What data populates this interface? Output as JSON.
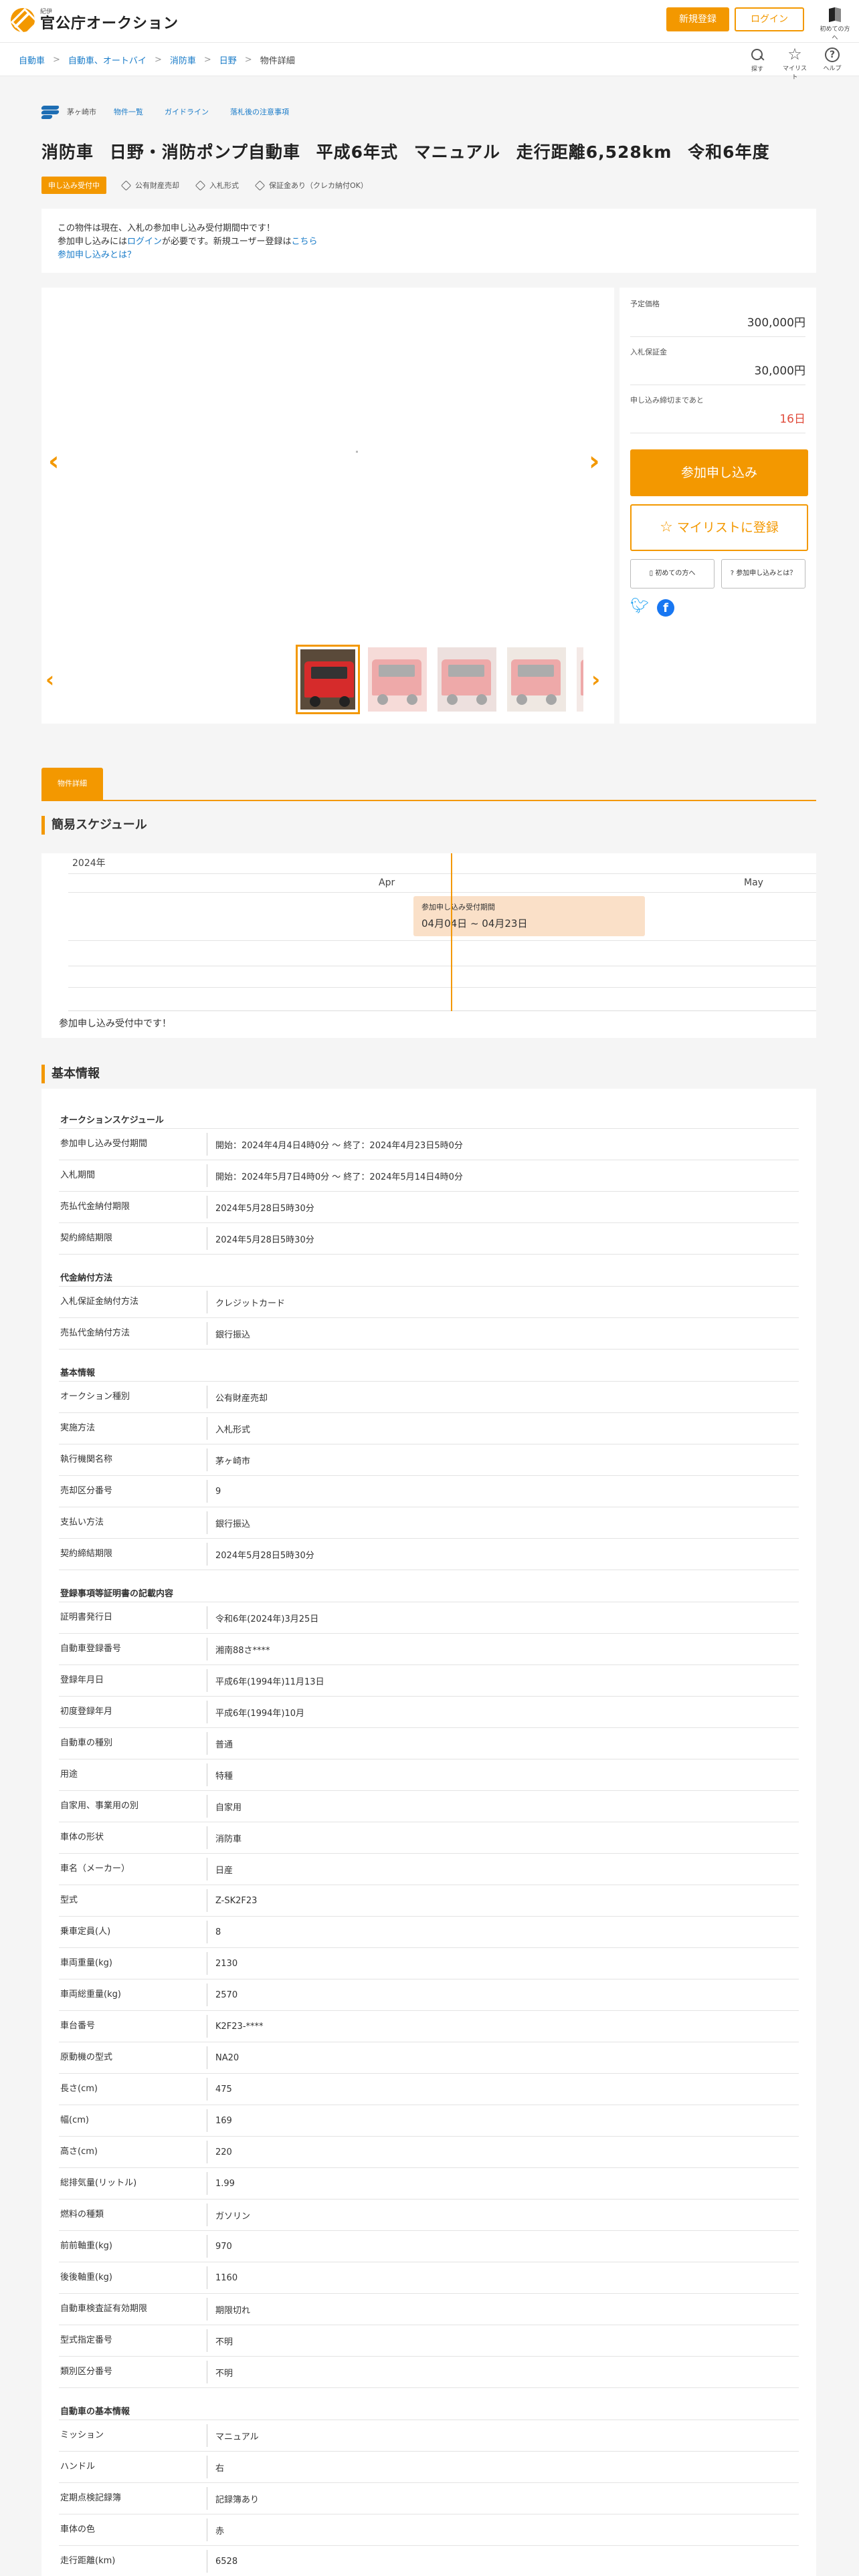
{
  "header": {
    "logo_sub": "紀伊",
    "logo_main": "官公庁オークション",
    "register_label": "新規登録",
    "login_label": "ログイン",
    "beginner_label": "初めての方へ"
  },
  "breadcrumb": [
    "自動車",
    "自動車、オートバイ",
    "消防車",
    "日野",
    "物件詳細"
  ],
  "tools": {
    "search": "探す",
    "mylist": "マイリスト",
    "help": "ヘルプ"
  },
  "subnav": {
    "org": "茅ヶ崎市",
    "links": [
      "物件一覧",
      "ガイドライン",
      "落札後の注意事項"
    ]
  },
  "title": "消防車 日野・消防ポンプ自動車 平成6年式 マニュアル 走行距離6,528km 令和6年度",
  "badge": "申し込み受付中",
  "tags": [
    "公有財産売却",
    "入札形式",
    "保証金あり（クレカ納付OK）"
  ],
  "notice": {
    "line1": "この物件は現在、入札の参加申し込み受付期間中です！",
    "line2_pre": "参加申し込みには",
    "line2_link": "ログイン",
    "line2_mid": "が必要です。新規ユーザー登録は",
    "line2_link2": "こちら",
    "line3_link": "参加申し込みとは？"
  },
  "side": {
    "price_label": "予定価格",
    "price": "300,000円",
    "deposit_label": "入札保証金",
    "deposit": "30,000円",
    "remain_label": "申し込み締切まであと",
    "remain": "16日",
    "join_label": "参加申し込み",
    "mylist_label": "マイリストに登録",
    "first_label": "初めての方へ",
    "what_label": "参加申し込みとは？"
  },
  "tab_label": "物件詳細",
  "schedule": {
    "heading": "簡易スケジュール",
    "year": "2024年",
    "months": [
      "Apr",
      "May"
    ],
    "bar_title": "参加申し込み受付期間",
    "bar_dates": "04月04日 ~ 04月23日",
    "status": "参加申し込み受付中です！"
  },
  "basic": {
    "heading": "基本情報",
    "groups": [
      {
        "title": "オークションスケジュール",
        "rows": [
          [
            "参加申し込み受付期間",
            "開始：2024年4月4日4時0分 ～ 終了：2024年4月23日5時0分"
          ],
          [
            "入札期間",
            "開始：2024年5月7日4時0分 ～ 終了：2024年5月14日4時0分"
          ],
          [
            "売払代金納付期限",
            "2024年5月28日5時30分"
          ],
          [
            "契約締結期限",
            "2024年5月28日5時30分"
          ]
        ]
      },
      {
        "title": "代金納付方法",
        "rows": [
          [
            "入札保証金納付方法",
            "クレジットカード"
          ],
          [
            "売払代金納付方法",
            "銀行振込"
          ]
        ]
      },
      {
        "title": "基本情報",
        "rows": [
          [
            "オークション種別",
            "公有財産売却"
          ],
          [
            "実施方法",
            "入札形式"
          ],
          [
            "執行機関名称",
            "茅ヶ崎市"
          ],
          [
            "売却区分番号",
            "9"
          ],
          [
            "支払い方法",
            "銀行振込"
          ],
          [
            "契約締結期限",
            "2024年5月28日5時30分"
          ]
        ]
      },
      {
        "title": "登録事項等証明書の記載内容",
        "rows": [
          [
            "証明書発行日",
            "令和6年(2024年)3月25日"
          ],
          [
            "自動車登録番号",
            "湘南88さ****"
          ],
          [
            "登録年月日",
            "平成6年(1994年)11月13日"
          ],
          [
            "初度登録年月",
            "平成6年(1994年)10月"
          ],
          [
            "自動車の種別",
            "普通"
          ],
          [
            "用途",
            "特種"
          ],
          [
            "自家用、事業用の別",
            "自家用"
          ],
          [
            "車体の形状",
            "消防車"
          ],
          [
            "車名（メーカー）",
            "日産"
          ],
          [
            "型式",
            "Z-SK2F23"
          ],
          [
            "乗車定員(人)",
            "8"
          ],
          [
            "車両重量(kg)",
            "2130"
          ],
          [
            "車両総重量(kg)",
            "2570"
          ],
          [
            "車台番号",
            "K2F23-****"
          ],
          [
            "原動機の型式",
            "NA20"
          ],
          [
            "長さ(cm)",
            "475"
          ],
          [
            "幅(cm)",
            "169"
          ],
          [
            "高さ(cm)",
            "220"
          ],
          [
            "総排気量(リットル)",
            "1.99"
          ],
          [
            "燃料の種類",
            "ガソリン"
          ],
          [
            "前前軸重(kg)",
            "970"
          ],
          [
            "後後軸重(kg)",
            "1160"
          ],
          [
            "自動車検査証有効期限",
            "期限切れ"
          ],
          [
            "型式指定番号",
            "不明"
          ],
          [
            "類別区分番号",
            "不明"
          ]
        ]
      },
      {
        "title": "自動車の基本情報",
        "rows": [
          [
            "ミッション",
            "マニュアル"
          ],
          [
            "ハンドル",
            "右"
          ],
          [
            "定期点検記録簿",
            "記録簿あり"
          ],
          [
            "車体の色",
            "赤"
          ],
          [
            "走行距離(km)",
            "6528"
          ]
        ]
      }
    ]
  }
}
